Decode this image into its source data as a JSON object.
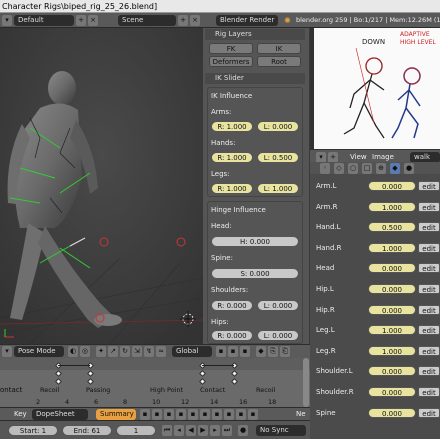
{
  "window": {
    "title": "Character Rigs\\biped_rig_25_26.blend]"
  },
  "topbar": {
    "layout": "Default",
    "scene": "Scene",
    "renderer": "Blender Render",
    "stats": "blender.org 259 | Bo:1/217 | Mem:12.26M (18.0"
  },
  "props": {
    "rig_layers_title": "Rig Layers",
    "fk_label": "FK",
    "ik_label": "IK",
    "deformers_label": "Deformers",
    "root_label": "Root",
    "ik_slider_title": "IK Slider",
    "ik_influence_label": "IK Influence",
    "arms_label": "Arms:",
    "arms_r": "R: 1.000",
    "arms_l": "L: 0.000",
    "hands_label": "Hands:",
    "hands_r": "R: 1.000",
    "hands_l": "L: 0.500",
    "legs_label": "Legs:",
    "legs_r": "R: 1.000",
    "legs_l": "L: 1.000",
    "hinge_title": "Hinge Influence",
    "head_label": "Head:",
    "head_val": "H: 0.000",
    "spine_label": "Spine:",
    "spine_val": "S: 0.000",
    "shoulders_label": "Shoulders:",
    "shoulders_r": "R: 0.000",
    "shoulders_l": "L: 0.000",
    "hips_label": "Hips:",
    "hips_r": "R: 0.000",
    "hips_l": "L: 0.000"
  },
  "imagewin": {
    "sketch_text_1": "DOWN",
    "sketch_text_2": "ADAPTIVE",
    "sketch_text_3": "HIGH LEVEL",
    "menu_view": "View",
    "menu_image": "Image",
    "image_name": "walk vo"
  },
  "shape_rows": [
    {
      "name": "Arm.L",
      "value": "0.000"
    },
    {
      "name": "Arm.R",
      "value": "1.000"
    },
    {
      "name": "Hand.L",
      "value": "0.500"
    },
    {
      "name": "Hand.R",
      "value": "1.000"
    },
    {
      "name": "Head",
      "value": "0.000"
    },
    {
      "name": "Hip.L",
      "value": "0.000"
    },
    {
      "name": "Hip.R",
      "value": "0.000"
    },
    {
      "name": "Leg.L",
      "value": "1.000"
    },
    {
      "name": "Leg.R",
      "value": "1.000"
    },
    {
      "name": "Shoulder.L",
      "value": "0.000"
    },
    {
      "name": "Shoulder.R",
      "value": "0.000"
    },
    {
      "name": "Spine",
      "value": "0.000"
    }
  ],
  "edit_label": "edit",
  "hdr3d": {
    "mode": "Pose Mode",
    "orientation": "Global"
  },
  "dope": {
    "contact_label": "ontact",
    "markers": [
      "Recoil",
      "Passing",
      "High Point",
      "Contact",
      "Recoil"
    ],
    "frames": [
      "2",
      "4",
      "6",
      "8",
      "10",
      "12",
      "14",
      "16",
      "18"
    ]
  },
  "dopehdr": {
    "key": "Key",
    "editor": "DopeSheet",
    "summary": "Summary",
    "ne": "Ne"
  },
  "timeline": {
    "start": "Start: 1",
    "end": "End: 61",
    "current": "1",
    "sync": "No Sync"
  }
}
